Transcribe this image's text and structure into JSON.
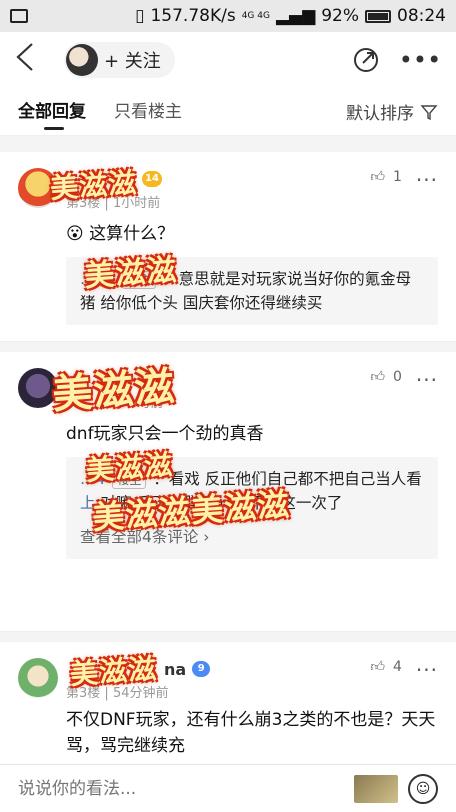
{
  "status_bar": {
    "speed": "157.78K/s",
    "network": "4G 4G",
    "battery": "92%",
    "time": "08:24"
  },
  "header": {
    "follow_label": "+ 关注"
  },
  "tabs": [
    {
      "label": "全部回复",
      "active": true
    },
    {
      "label": "只看楼主",
      "active": false
    }
  ],
  "sort_label": "默认排序",
  "comments": [
    {
      "level": "14",
      "floor": "第3楼",
      "time": "1小时前",
      "likes": "1",
      "body": "这算什么？",
      "reply": {
        "user": "…84",
        "tag": "楼主",
        "text": "：意思就是对玩家说当好你的氪金母猪 给你低个头 国庆套你还得继续买"
      },
      "sticker": "美滋滋"
    },
    {
      "floor": "",
      "time": "1小时前",
      "likes": "0",
      "body": "dnf玩家只会一个劲的真香",
      "reply1": {
        "user": "…4",
        "tag": "楼主",
        "text": "：看戏 反正他们自己都不把自己当人看"
      },
      "reply2": {
        "user": "上",
        "text": "对嘛 反正一群抖m 也不缺这一次了"
      },
      "view_all": "查看全部4条评论",
      "sticker": "美滋滋",
      "sticker2": "美滋滋",
      "sticker3": "美滋滋美滋滋"
    },
    {
      "name_suffix": "na",
      "level": "9",
      "floor": "第3楼",
      "time": "54分钟前",
      "likes": "4",
      "body": "不仅DNF玩家，还有什么崩3之类的不也是？天天骂，骂完继续充",
      "sticker": "美滋滋"
    }
  ],
  "bottom": {
    "placeholder": "说说你的看法..."
  }
}
